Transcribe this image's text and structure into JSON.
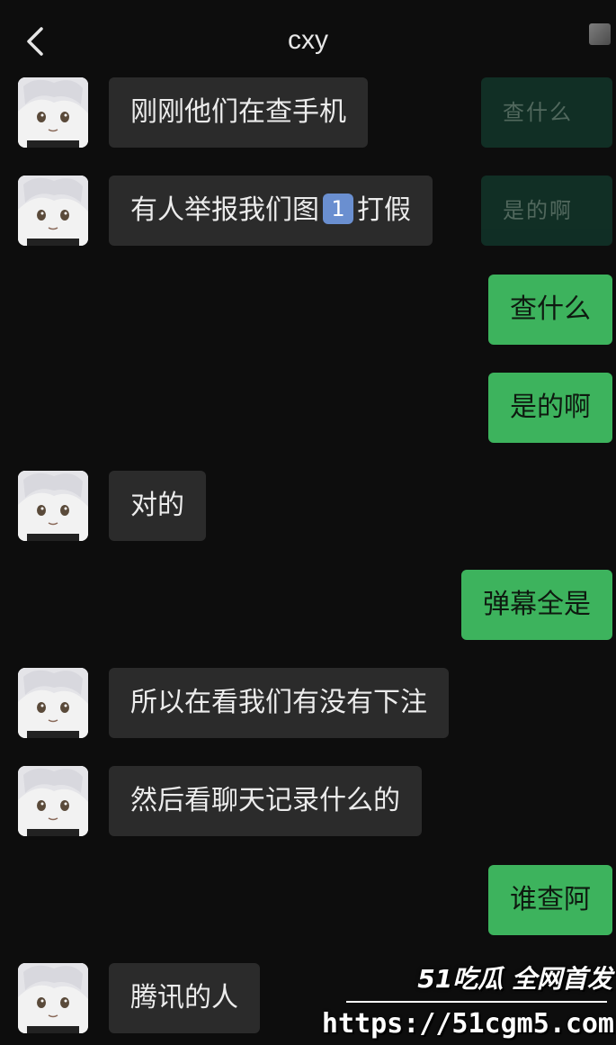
{
  "header": {
    "title": "cxy"
  },
  "messages": [
    {
      "side": "in",
      "text": "刚刚他们在查手机"
    },
    {
      "side": "out-faded",
      "text": "查什么"
    },
    {
      "side": "in",
      "text_before": "有人举报我们图",
      "badge": "1",
      "text_after": "打假"
    },
    {
      "side": "out-faded",
      "text": "是的啊"
    },
    {
      "side": "out",
      "text": "查什么"
    },
    {
      "side": "out",
      "text": "是的啊"
    },
    {
      "side": "in",
      "text": "对的"
    },
    {
      "side": "out",
      "text": "弹幕全是"
    },
    {
      "side": "in",
      "text": "所以在看我们有没有下注"
    },
    {
      "side": "in",
      "text": "然后看聊天记录什么的"
    },
    {
      "side": "out",
      "text": "谁查阿"
    },
    {
      "side": "in",
      "text": "腾讯的人"
    }
  ],
  "watermark": {
    "brand": "51吃瓜 全网首发",
    "url": "https://51cgm5.com"
  },
  "colors": {
    "background": "#0d0d0d",
    "incoming_bubble": "#2b2b2b",
    "outgoing_bubble": "#3db35d"
  }
}
